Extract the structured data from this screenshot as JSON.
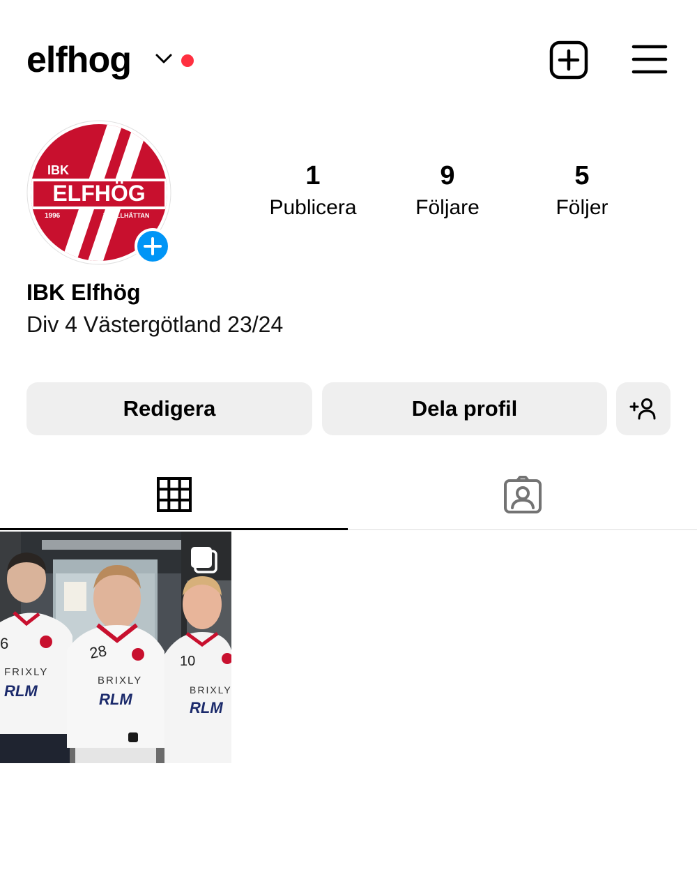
{
  "header": {
    "username": "elfhog",
    "icons": {
      "switch_account": "chevron-down-icon",
      "notification": "notification-dot",
      "new_post": "plus-square-icon",
      "menu": "hamburger-menu-icon"
    },
    "notification_color": "#ff3040"
  },
  "profile": {
    "avatar": {
      "logo_texts": [
        "IBK",
        "ELFHÖG",
        "1996",
        "TROLLHÄTTAN"
      ],
      "brand_color": "#c8102e",
      "add_story_icon": "plus-circle-icon",
      "add_story_color": "#0095f6"
    },
    "stats": [
      {
        "value": "1",
        "label": "Publicera"
      },
      {
        "value": "9",
        "label": "Följare"
      },
      {
        "value": "5",
        "label": "Följer"
      }
    ],
    "display_name": "IBK Elfhög",
    "bio": "Div 4 Västergötland 23/24"
  },
  "actions": {
    "edit_label": "Redigera",
    "share_label": "Dela profil",
    "add_friend_icon": "add-person-icon"
  },
  "tabs": [
    {
      "icon": "grid-icon",
      "active": true
    },
    {
      "icon": "tagged-person-icon",
      "active": false
    }
  ],
  "posts": [
    {
      "description_icon": "carousel-multiple-icon",
      "jersey_numbers": [
        "6",
        "28",
        "10"
      ],
      "sponsor_texts": [
        "FRIXLY",
        "BRIXLY",
        "RLM",
        "BRIXLY",
        "RLM",
        "RLM"
      ]
    }
  ]
}
